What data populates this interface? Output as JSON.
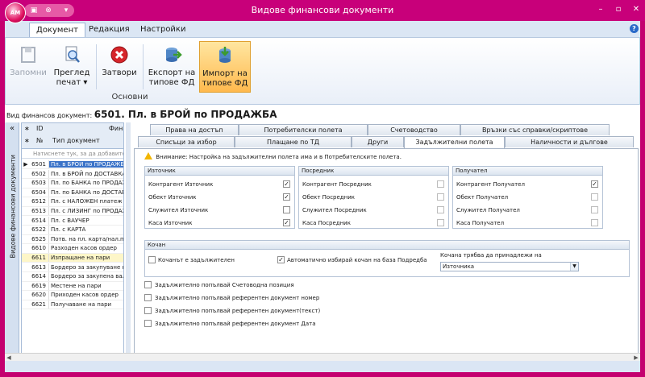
{
  "window": {
    "title": "Видове финансови документи",
    "app_orb": "AM"
  },
  "quick_access": {
    "items": [
      "save-icon",
      "undo-icon",
      "dropdown-icon"
    ]
  },
  "ribbon": {
    "tabs": [
      {
        "label": "Документ",
        "active": true
      },
      {
        "label": "Редакция"
      },
      {
        "label": "Настройки"
      }
    ],
    "group_label": "Основни",
    "buttons": {
      "save": {
        "label": "Запомни",
        "disabled": true
      },
      "preview": {
        "line1": "Преглед",
        "line2": "печат"
      },
      "close": {
        "label": "Затвори"
      },
      "export": {
        "line1": "Експорт на",
        "line2": "типове ФД"
      },
      "import": {
        "line1": "Импорт на",
        "line2": "типове ФД"
      }
    }
  },
  "doc": {
    "label": "Вид финансов документ:",
    "value": "6501. Пл. в БРОЙ по ПРОДАЖБА"
  },
  "sidebar": {
    "vertical_label": "Видове финансови документи"
  },
  "grid": {
    "headers": {
      "id": "ID",
      "fina": "Фина",
      "no": "№",
      "type": "Тип документ"
    },
    "filter_placeholder": "Натиснете тук, за да добавите",
    "rows": [
      {
        "id": "6501",
        "name": "Пл. в БРОЙ по ПРОДАЖБА",
        "selected": true
      },
      {
        "id": "6502",
        "name": "Пл. в БРОЙ по ДОСТАВКА"
      },
      {
        "id": "6503",
        "name": "Пл. по БАНКА по ПРОДАЖБА"
      },
      {
        "id": "6504",
        "name": "Пл. по БАНКА по ДОСТАВКА"
      },
      {
        "id": "6512",
        "name": "Пл. с НАЛОЖЕН платеж"
      },
      {
        "id": "6513",
        "name": "Пл. с ЛИЗИНГ по ПРОДАЖБА"
      },
      {
        "id": "6514",
        "name": "Пл. с ВАУЧЕР"
      },
      {
        "id": "6522",
        "name": "Пл. с КАРТА"
      },
      {
        "id": "6525",
        "name": "Потв. на пл. карта/нал.п"
      },
      {
        "id": "6610",
        "name": "Разходен касов ордер"
      },
      {
        "id": "6611",
        "name": "Изпращане на пари",
        "yellow": true
      },
      {
        "id": "6613",
        "name": "Бордеро за закупуване на"
      },
      {
        "id": "6614",
        "name": "Бордеро за закупена вал"
      },
      {
        "id": "6619",
        "name": "Местене на пари"
      },
      {
        "id": "6620",
        "name": "Приходен касов ордер"
      },
      {
        "id": "6621",
        "name": "Получаване на пари"
      }
    ]
  },
  "tabs": {
    "row1": [
      "Права на достъп",
      "Потребителски полета",
      "Счетоводство",
      "Връзки със справки/скриптове"
    ],
    "row2": [
      "Списъци за избор",
      "Плащане по ТД",
      "Други",
      "Задължителни полета",
      "Наличности и дългове"
    ],
    "active": "Задължителни полета"
  },
  "required": {
    "warning": "Внимание: Настройка на задължителни полета има и в Потребителските полета.",
    "source": {
      "title": "Източник",
      "fields": [
        {
          "label": "Контрагент Източник",
          "checked": true
        },
        {
          "label": "Обект Източник",
          "checked": true
        },
        {
          "label": "Служител Източник",
          "checked": false
        },
        {
          "label": "Каса Източник",
          "checked": true
        }
      ]
    },
    "broker": {
      "title": "Посредник",
      "fields": [
        {
          "label": "Контрагент Посредник",
          "checked": false
        },
        {
          "label": "Обект Посредник",
          "checked": false
        },
        {
          "label": "Служител Посредник",
          "checked": false
        },
        {
          "label": "Каса Посредник",
          "checked": false
        }
      ]
    },
    "receiver": {
      "title": "Получател",
      "fields": [
        {
          "label": "Контрагент Получател",
          "checked": true
        },
        {
          "label": "Обект Получател",
          "checked": false
        },
        {
          "label": "Служител Получател",
          "checked": false
        },
        {
          "label": "Каса Получател",
          "checked": false
        }
      ]
    },
    "kochan": {
      "title": "Кочан",
      "required_label": "Кочанът е задължителен",
      "required_checked": false,
      "auto_label": "Автоматично избирай кочан на база Подредба",
      "auto_checked": true,
      "belongs_label": "Кочана трябва да принадлежи на",
      "belongs_value": "Източника"
    },
    "extra": [
      {
        "label": "Задължително попълвай Счетоводна позиция",
        "checked": false
      },
      {
        "label": "Задължително попълвай референтен документ номер",
        "checked": false
      },
      {
        "label": "Задължително попълвай референтен документ(текст)",
        "checked": false
      },
      {
        "label": "Задължително попълвай референтен документ Дата",
        "checked": false
      }
    ]
  },
  "colors": {
    "title_bar": "#c8007a",
    "ribbon_bg": "#dbe6f4",
    "selection": "#3b73c8",
    "hot_button": "#ffb94e"
  }
}
